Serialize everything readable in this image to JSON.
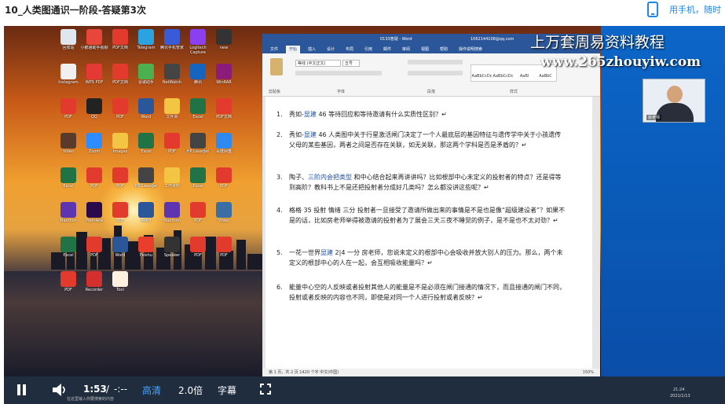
{
  "page": {
    "title": "10_人类图通识一阶段-答疑第3次",
    "mobile_link": "用手机，随时"
  },
  "watermark": {
    "line1": "上万套周易资料教程",
    "line2": "www.265zhouyiw.com"
  },
  "desktop": {
    "icons": [
      {
        "label": "回收站",
        "color": "#dfe6ee"
      },
      {
        "label": "小鹅通助手视频",
        "color": "#e8463a"
      },
      {
        "label": "PDF文档",
        "color": "#e23b2e"
      },
      {
        "label": "Telegram",
        "color": "#2aa3e0"
      },
      {
        "label": "腾讯手机管家",
        "color": "#3a5bd8"
      },
      {
        "label": "Logitech Capture",
        "color": "#8a3ff0"
      },
      {
        "label": "new",
        "color": "#333333"
      },
      {
        "label": "Instagram",
        "color": "#f0f0f0"
      },
      {
        "label": "WPS PDF",
        "color": "#e53935"
      },
      {
        "label": "PDF文档",
        "color": "#e23b2e"
      },
      {
        "label": "谷歌助手",
        "color": "#4caf50"
      },
      {
        "label": "NetWatch",
        "color": "#444444"
      },
      {
        "label": "腾讯",
        "color": "#1565c0"
      },
      {
        "label": "WinRAR",
        "color": "#8b1c7a"
      },
      {
        "label": "PDF",
        "color": "#e23b2e"
      },
      {
        "label": "QQ",
        "color": "#222222"
      },
      {
        "label": "PDF",
        "color": "#e23b2e"
      },
      {
        "label": "Word",
        "color": "#2b579a"
      },
      {
        "label": "文件夹",
        "color": "#f4c542"
      },
      {
        "label": "Excel",
        "color": "#217346"
      },
      {
        "label": "PDF文档",
        "color": "#e23b2e"
      },
      {
        "label": "Video",
        "color": "#5a3a2a"
      },
      {
        "label": "Zoom",
        "color": "#2d8cff"
      },
      {
        "label": "Images",
        "color": "#f4c542"
      },
      {
        "label": "Excel",
        "color": "#217346"
      },
      {
        "label": "PDF",
        "color": "#e23b2e"
      },
      {
        "label": "HP LaserJet",
        "color": "#444444"
      },
      {
        "label": "百度网盘",
        "color": "#2f8af0"
      },
      {
        "label": "Excel",
        "color": "#217346"
      },
      {
        "label": "PDF",
        "color": "#e23b2e"
      },
      {
        "label": "PDF",
        "color": "#e23b2e"
      },
      {
        "label": "HP LaserJet",
        "color": "#444444"
      },
      {
        "label": "工作资料",
        "color": "#f4c542"
      },
      {
        "label": "Excel",
        "color": "#217346"
      },
      {
        "label": "PDF",
        "color": "#e23b2e"
      },
      {
        "label": "Maxthon",
        "color": "#5e35b1"
      },
      {
        "label": "Premiere",
        "color": "#2a0a4a"
      },
      {
        "label": "PDF",
        "color": "#e23b2e"
      },
      {
        "label": "Word",
        "color": "#2b579a"
      },
      {
        "label": "Maxthon",
        "color": "#5e35b1"
      },
      {
        "label": "PDF",
        "color": "#e23b2e"
      },
      {
        "label": "Video",
        "color": "#3a6ea5"
      },
      {
        "label": "Excel",
        "color": "#217346"
      },
      {
        "label": "PDF",
        "color": "#e23b2e"
      },
      {
        "label": "Word",
        "color": "#2b579a"
      },
      {
        "label": "Feishu",
        "color": "#e83e2b"
      },
      {
        "label": "Speaker",
        "color": "#333333"
      },
      {
        "label": "PDF",
        "color": "#e23b2e"
      },
      {
        "label": "PDF",
        "color": "#e23b2e"
      },
      {
        "label": "PDF",
        "color": "#e23b2e"
      },
      {
        "label": "Recorder",
        "color": "#d32f2f"
      },
      {
        "label": "Tool",
        "color": "#fff0e0"
      }
    ]
  },
  "word": {
    "window_title": "0133答疑 - Word",
    "user_email": "1062144108@qq.com",
    "tabs": [
      "文件",
      "开始",
      "插入",
      "设计",
      "布局",
      "引用",
      "邮件",
      "审阅",
      "视图",
      "帮助",
      "操作说明搜索"
    ],
    "active_tab": "开始",
    "font_name": "等线 (中文正文)",
    "font_size": "五号",
    "group_clipboard": "剪贴板",
    "group_font": "字体",
    "group_paragraph": "段落",
    "group_styles": "样式",
    "styles": [
      "AaBbCcDc",
      "AaBbCcDc",
      "AaBl",
      "AaBbC"
    ],
    "questions": [
      {
        "num": "1.",
        "name": "秀如-",
        "tag": "显建",
        "text": "46 等待回应和等待邀请有什么实质性区别？↵"
      },
      {
        "num": "2.",
        "name": "秀如-",
        "tag": "显建",
        "text": "46 人类图中关于行星激活闸门决定了一个人最底层的基因特征与遗传学中关于小孩遗传父母的某些基因，两者之间是否存在关联，如无关联，那这两个学科是否是矛盾的？↵"
      },
      {
        "num": "3.",
        "name": "陶子、",
        "tag": "三阶内会把类型",
        "text": "和中心结合起来再讲讲吗？比如根部中心未定义的投射者的特点？还是得等到高阶？教科书上不是还把投射者分成好几类吗？怎么都没讲这些呢？↵"
      },
      {
        "num": "4.",
        "name": "",
        "tag": "",
        "text": "格格 35 投射 情绪 三分 投射者一旦接受了邀请所做出来的事情是不是也是像“超级建设者”？如果不是的话，比如房老师举得被邀请的投射者为了展会三天三夜不睡觉的例子，是不是也不太对劲？↵"
      },
      {
        "num": "5.",
        "name": "一花一世界",
        "tag": "显建",
        "text": "2|4 一分 房老师，您说未定义的根部中心会吸收并放大别人的压力。那么，两个未定义的根部中心的人在一起，会互相吸收能量吗？↵"
      },
      {
        "num": "6.",
        "name": "",
        "tag": "",
        "text": "能量中心空的人反映或者投射其他人的能量是不是必须在闸门接通的情况下，而且接通的闸门不同，投射或者反映的内容也不同，即使是对同一个人进行投射或者反映？↵"
      }
    ],
    "status": "第 1 页，共 2 页   1420 个字   中文(中国)",
    "zoom": "150%"
  },
  "webcam": {
    "label": "房老师"
  },
  "player": {
    "time_current": "1:53",
    "time_separator": "/",
    "time_total": "-:--",
    "quality": "高清",
    "speed": "2.0倍",
    "subtitles": "字幕"
  },
  "taskbar": {
    "search_placeholder": "在这里输入你要搜索的内容",
    "clock_time": "21:24",
    "clock_date": "2021/1/13"
  }
}
